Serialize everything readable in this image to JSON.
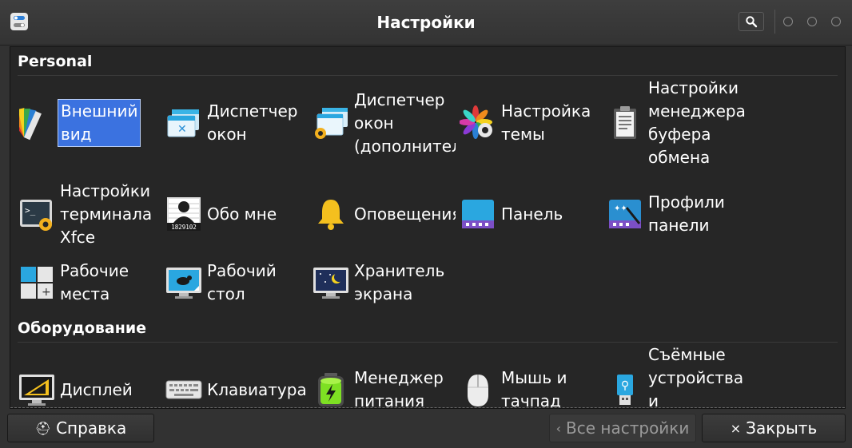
{
  "window": {
    "title": "Настройки"
  },
  "sections": [
    {
      "title": "Personal"
    },
    {
      "title": "Оборудование"
    }
  ],
  "items": [
    {
      "label": "Внешний\nвид",
      "icon": "appearance-icon"
    },
    {
      "label": "Диспетчер\nокон",
      "icon": "window-manager-icon"
    },
    {
      "label": "Диспетчер\nокон\n(дополнитель",
      "icon": "window-manager-tweaks-icon"
    },
    {
      "label": "Настройка\nтемы",
      "icon": "theme-settings-icon"
    },
    {
      "label": "Настройки\nменеджера\nбуфера\nобмена",
      "icon": "clipboard-icon"
    },
    {
      "label": "Настройки\nтерминала\nXfce",
      "icon": "terminal-settings-icon"
    },
    {
      "label": "Обо мне",
      "icon": "about-me-icon",
      "badge": "1829102"
    },
    {
      "label": "Оповещения",
      "icon": "bell-icon"
    },
    {
      "label": "Панель",
      "icon": "panel-icon"
    },
    {
      "label": "Профили\nпанели",
      "icon": "panel-profiles-icon"
    },
    {
      "label": "Рабочие\nместа",
      "icon": "workspaces-icon"
    },
    {
      "label": "Рабочий\nстол",
      "icon": "desktop-icon"
    },
    {
      "label": "Хранитель\nэкрана",
      "icon": "screensaver-icon"
    },
    {
      "label": "Дисплей",
      "icon": "display-icon"
    },
    {
      "label": "Клавиатура",
      "icon": "keyboard-icon"
    },
    {
      "label": "Менеджер\nпитания",
      "icon": "power-manager-icon"
    },
    {
      "label": "Мышь и\nтачпад",
      "icon": "mouse-icon"
    },
    {
      "label": "Съёмные\nустройства и\nносители",
      "icon": "removable-drives-icon"
    }
  ],
  "buttons": {
    "help": "Справка",
    "all_settings": "Все настройки",
    "close": "Закрыть"
  },
  "colors": {
    "selection": "#3b72e0",
    "background": "#262626"
  }
}
